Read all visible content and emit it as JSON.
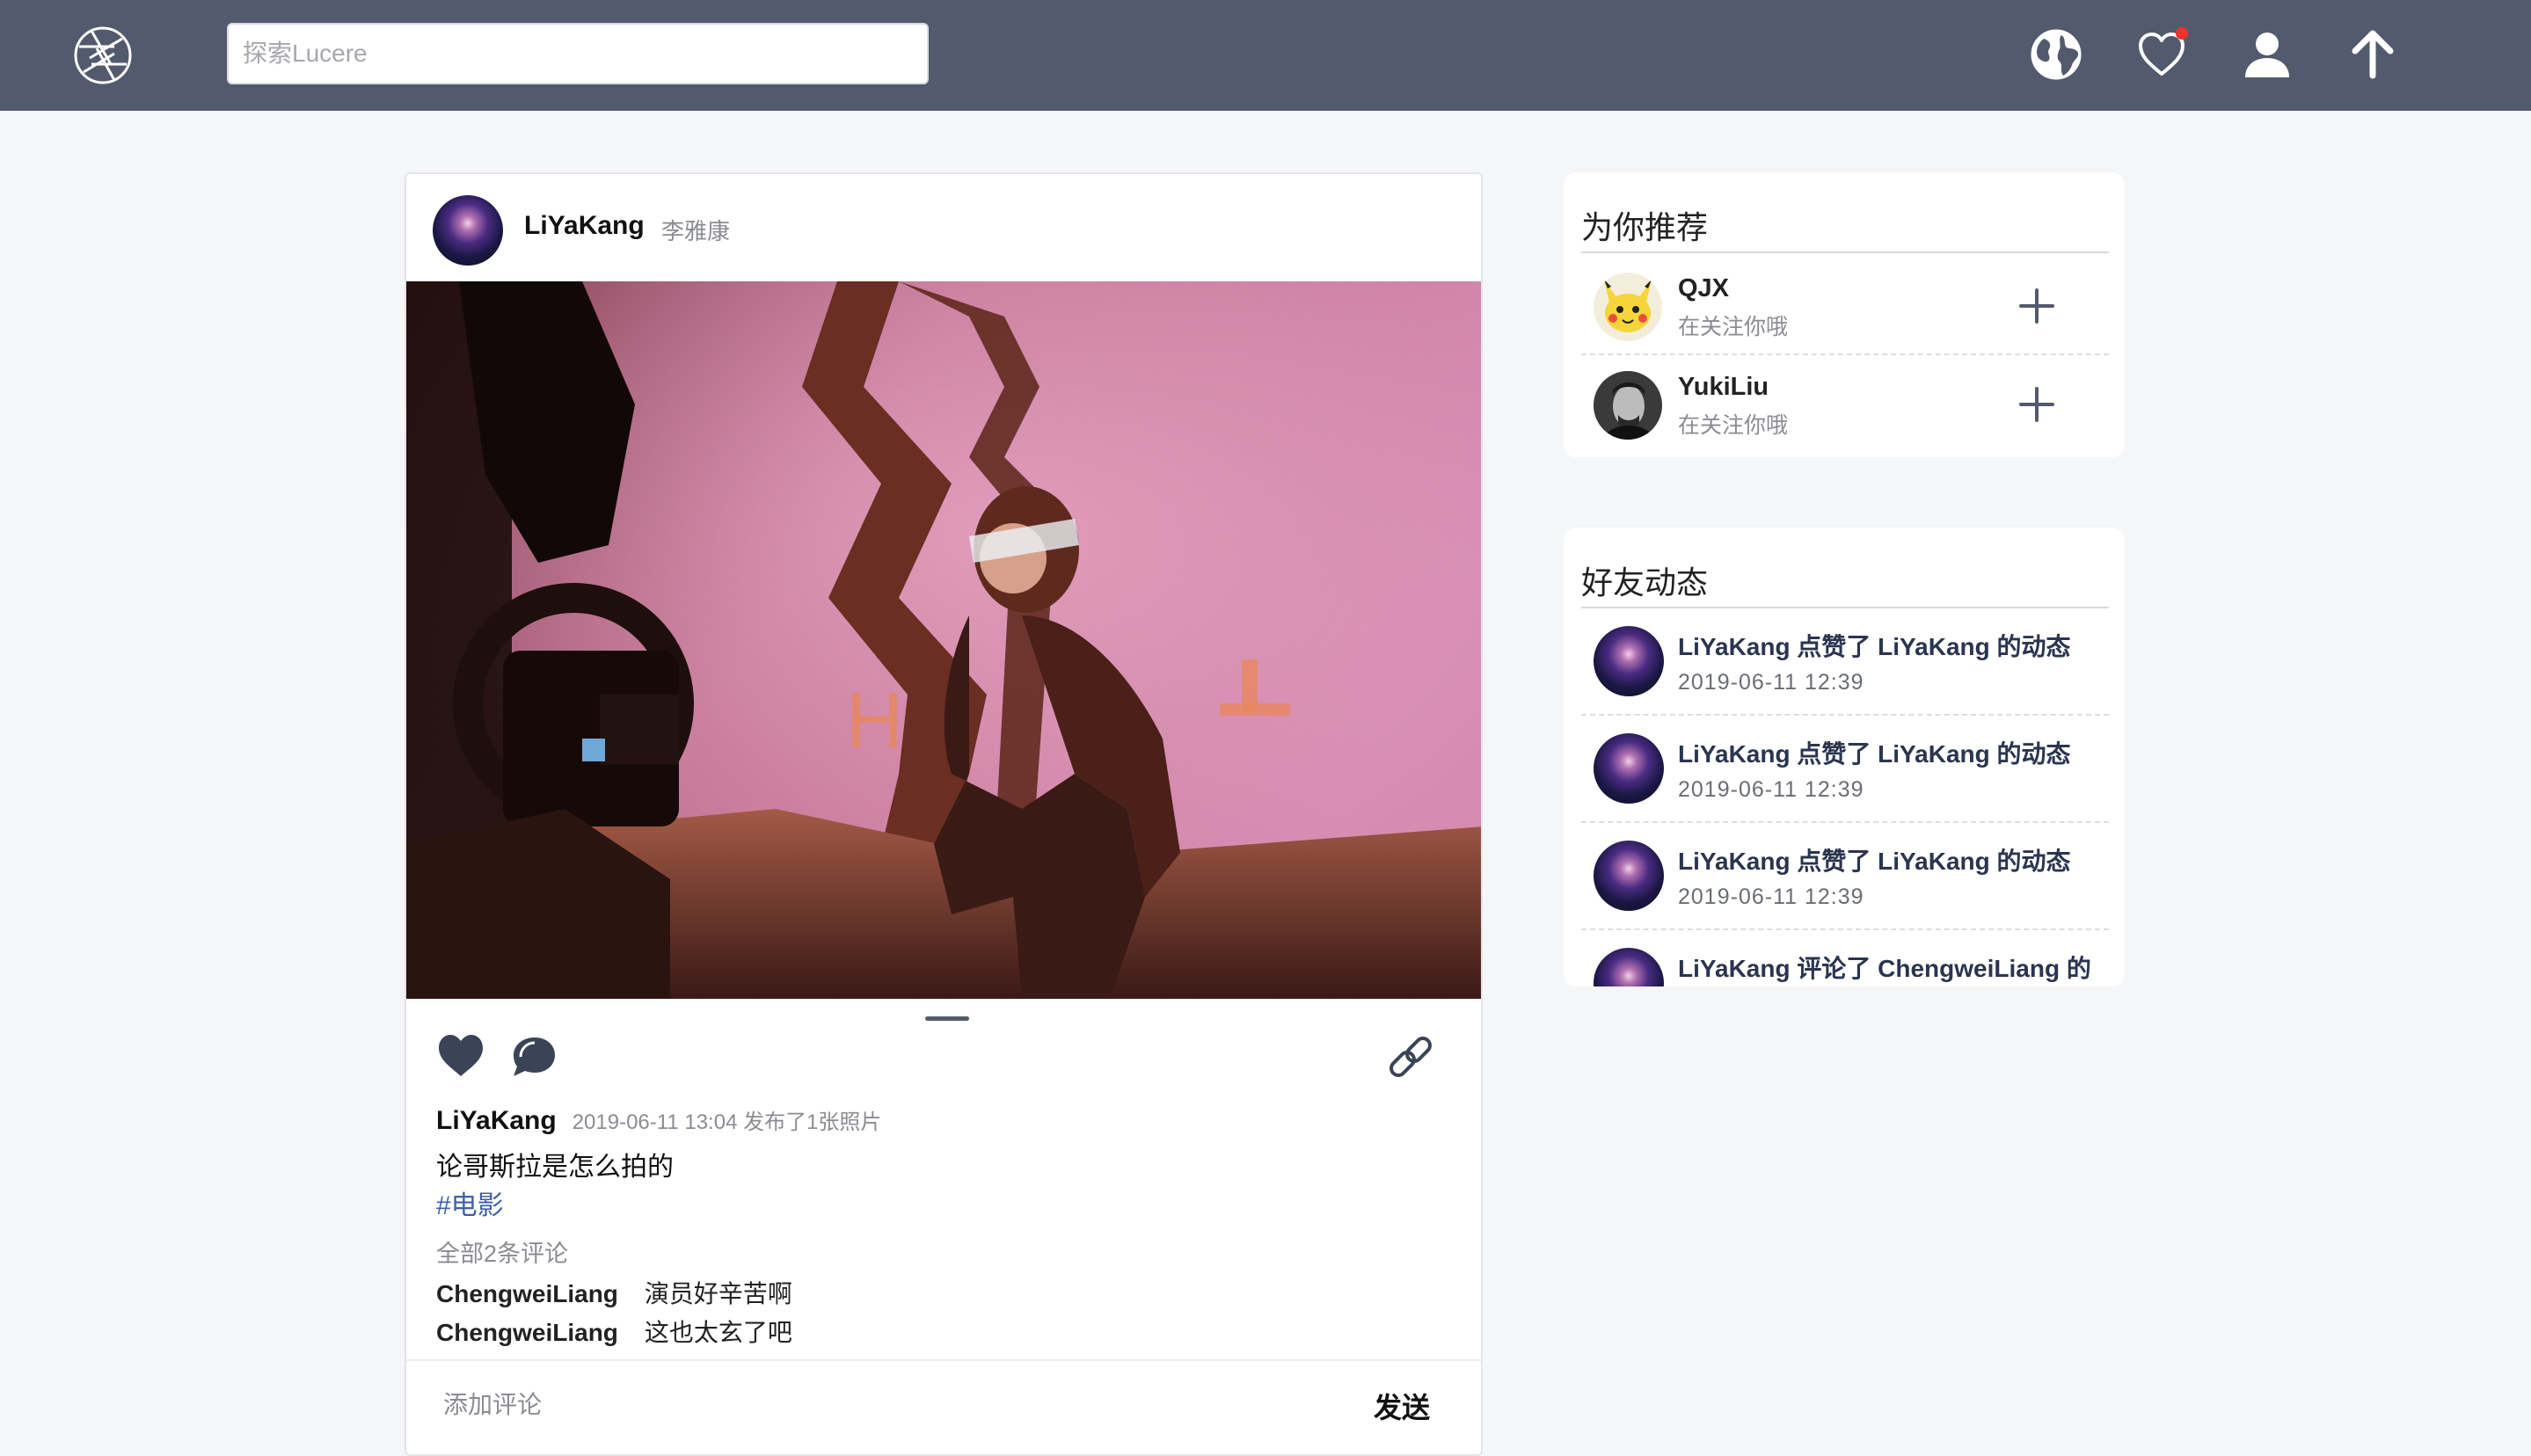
{
  "topbar": {
    "search_placeholder": "探索Lucere",
    "icons": [
      "aperture-logo-icon",
      "globe-icon",
      "heart-icon",
      "user-icon",
      "arrow-up-icon"
    ],
    "has_notification": true,
    "colors": {
      "bar": "#545a6d",
      "notification": "#f0322d"
    }
  },
  "post": {
    "author": "LiYaKang",
    "real_name": "李雅康",
    "image_count_dots": 1,
    "meta_info": "2019-06-11 13:04 发布了1张照片",
    "caption": "论哥斯拉是怎么拍的",
    "hashtag": "#电影",
    "comment_count": "全部2条评论",
    "comments": [
      {
        "user": "ChengweiLiang",
        "text": "演员好辛苦啊"
      },
      {
        "user": "ChengweiLiang",
        "text": "这也太玄了吧"
      }
    ],
    "comment_placeholder": "添加评论",
    "send_label": "发送"
  },
  "recommend": {
    "title": "为你推荐",
    "items": [
      {
        "name": "QJX",
        "sub": "在关注你哦"
      },
      {
        "name": "YukiLiu",
        "sub": "在关注你哦"
      }
    ]
  },
  "feed": {
    "title": "好友动态",
    "items": [
      {
        "text": "LiYaKang 点赞了 LiYaKang 的动态",
        "time": "2019-06-11 12:39"
      },
      {
        "text": "LiYaKang 点赞了 LiYaKang 的动态",
        "time": "2019-06-11 12:39"
      },
      {
        "text": "LiYaKang 点赞了 LiYaKang 的动态",
        "time": "2019-06-11 12:39"
      },
      {
        "text": "LiYaKang 评论了 ChengweiLiang 的",
        "time": ""
      }
    ]
  }
}
